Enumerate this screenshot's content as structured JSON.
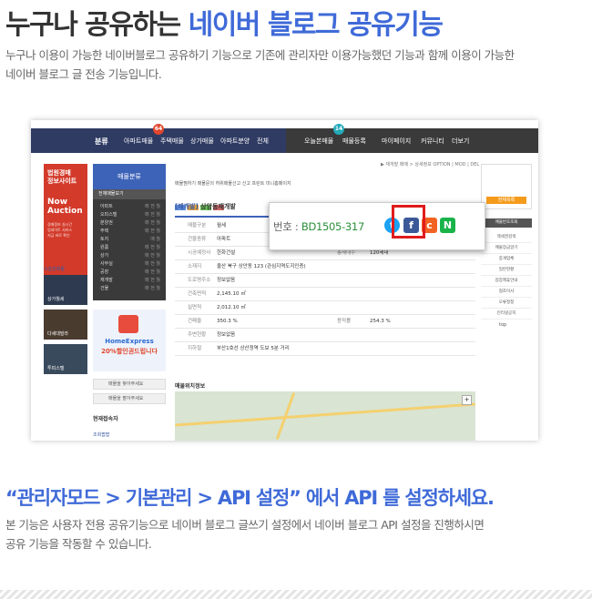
{
  "header": {
    "title_part1": "누구나 공유하는 ",
    "title_part2": "네이버 블로그 공유기능",
    "desc_line1": "누구나 이용이 가능한 네이버블로그 공유하기 기능으로 기존에 관리자만 이용가능했던 기능과 함께 이용이 가능한",
    "desc_line2": "네이버 블로그 글 전송 기능입니다."
  },
  "screenshot": {
    "nav": {
      "brand": "분류",
      "items_left": [
        "아파트매물",
        "주택매물",
        "상가매물",
        "아파트분양",
        "전체"
      ],
      "items_right": [
        "오늘본매물",
        "매물등록",
        "마이페이지",
        "커뮤니티",
        "더보기"
      ],
      "badge_left": "64",
      "badge_right": "14"
    },
    "breadcrumb": "▶ 재개발 매매 > 상세정보   OPTION | MOD | DEL",
    "banner": {
      "line1a": "법원경매",
      "line1b": "정보사이트",
      "line2a": "Now",
      "line2b": "Auction",
      "line3a": "경매정보 실시간",
      "line3b": "업데이트 서비스",
      "line3c": "지금 바로 확인"
    },
    "side_caption": "오늘본매물",
    "thumbs": [
      "상가월세",
      "다세대빌라",
      "투피스텔"
    ],
    "category": {
      "head": "매물분류",
      "selected": "전체매물보기",
      "rows": [
        {
          "label": "아파트",
          "count": "매 전 월"
        },
        {
          "label": "오피스텔",
          "count": "매 전 월"
        },
        {
          "label": "분양권",
          "count": "매 전 월"
        },
        {
          "label": "주택",
          "count": "매 전 월"
        },
        {
          "label": "토지",
          "count": "매 월"
        },
        {
          "label": "원룸",
          "count": "매 전 월"
        },
        {
          "label": "상가",
          "count": "매 전 월"
        },
        {
          "label": "사무실",
          "count": "매 전 월"
        },
        {
          "label": "공장",
          "count": "매 전 월"
        },
        {
          "label": "재개발",
          "count": "매 전 월"
        },
        {
          "label": "건물",
          "count": "매 전 월"
        }
      ]
    },
    "promo": {
      "line1": "HomeExpress",
      "line2": "20%할인권드립니다"
    },
    "small_buttons": [
      "매물을 찾아주세요",
      "매물을 팔아주세요"
    ],
    "now_visitors": "현재접속자",
    "now_sub": "조회짭짭",
    "icon_row": "매물찜하기   매물문의   허위매물신고   신고   프린트   미니홈페이지",
    "property_title": "상암동재개발",
    "property_prefix": "[재개발]",
    "table_rows": [
      {
        "lab": "매물구분",
        "val": "월세",
        "lab2": "",
        "val2": ""
      },
      {
        "lab": "건물종류",
        "val": "아파트",
        "lab2": "",
        "val2": ""
      },
      {
        "lab": "시공예정사",
        "val": "한화건설",
        "lab2": "총세대수",
        "val2": "120세대"
      },
      {
        "lab": "소재지",
        "val": "울산 북구 상안동 123 (관심지역도지인증)",
        "lab2": "",
        "val2": ""
      },
      {
        "lab": "도로명주소",
        "val": "정보없음",
        "lab2": "",
        "val2": ""
      },
      {
        "lab": "건축면적",
        "val": "2,145.10 ㎡",
        "lab2": "",
        "val2": ""
      },
      {
        "lab": "실면적",
        "val": "2,012.10 ㎡",
        "lab2": "",
        "val2": ""
      },
      {
        "lab": "건폐율",
        "val": "350.3 %",
        "lab2": "용적률",
        "val2": "254.3 %"
      },
      {
        "lab": "주변현황",
        "val": "정보없음",
        "lab2": "",
        "val2": ""
      },
      {
        "lab": "지하철",
        "val": "부산1호선 상산정역 도보 5분 거리",
        "lab2": "",
        "val2": ""
      }
    ],
    "map_title": "매물위치정보",
    "right_panel": {
      "btn": "전체목록",
      "head": "매물번호조회",
      "links": [
        "맥세권검색",
        "매물장금알기",
        "중개업체",
        "일반현황",
        "업장제휴안내",
        "협조이사",
        "오류정정",
        "인터넷공지"
      ],
      "top": "top"
    },
    "callout": {
      "code_label": "번호 : ",
      "code_value": "BD1505-317",
      "icons": {
        "twitter": "t",
        "facebook": "f",
        "kakao": "c",
        "naver": "N"
      }
    }
  },
  "footer_section": {
    "subtitle": "“관리자모드 > 기본관리 > API 설정” 에서 API 를 설정하세요.",
    "desc_line1": "본 기능은 사용자 전용 공유기능으로 네이버 블로그 글쓰기 설정에서 네이버 블로그 API 설정을 진행하시면",
    "desc_line2": "공유 기능을 작동할 수 있습니다."
  },
  "colors": {
    "accent": "#3f6ad8",
    "nav_dark": "#2f3b63",
    "highlight_red": "#e01b1b",
    "naver_green": "#19b34a"
  }
}
